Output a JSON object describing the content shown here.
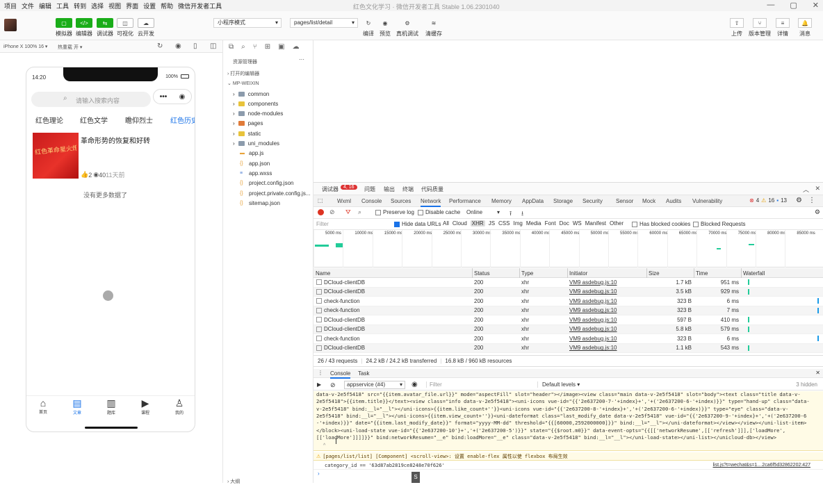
{
  "menu": [
    "项目",
    "文件",
    "编辑",
    "工具",
    "转到",
    "选择",
    "视图",
    "界面",
    "设置",
    "帮助",
    "微信开发者工具"
  ],
  "window_title": "红色文化学习 · 微信开发者工具 Stable 1.06.2301040",
  "toolbar": {
    "left": [
      {
        "label": "模拟器",
        "icon": "▢"
      },
      {
        "label": "编辑器",
        "icon": "</>"
      },
      {
        "label": "调试器",
        "icon": "⇆"
      },
      {
        "label": "可视化",
        "icon": "◫"
      },
      {
        "label": "云开发",
        "icon": "☁"
      }
    ],
    "compile_mode": "小程序模式",
    "page_path": "pages/list/detail",
    "mid": [
      {
        "label": "编译",
        "icon": "↻"
      },
      {
        "label": "预览",
        "icon": "◉"
      },
      {
        "label": "真机调试",
        "icon": "⚙"
      },
      {
        "label": "清缓存",
        "icon": "≋"
      }
    ],
    "right": [
      {
        "label": "上传",
        "icon": "⇧"
      },
      {
        "label": "版本管理",
        "icon": "⑂"
      },
      {
        "label": "详情",
        "icon": "≡"
      },
      {
        "label": "消息",
        "icon": "🔔"
      }
    ]
  },
  "simbar": {
    "device": "iPhone X 100% 16 ▾",
    "hotreload": "热重载 开 ▾"
  },
  "phone": {
    "time": "14:20",
    "battery": "100%",
    "search_placeholder": "请输入搜索内容",
    "tabs": [
      "红色理论",
      "红色文学",
      "瞻仰烈士",
      "红色历史"
    ],
    "article": {
      "title": "革命形势的恢复和好转",
      "likes": "2",
      "views": "40",
      "date": "11天前",
      "thumb_text": "红色革命星火燎原"
    },
    "no_more": "没有更多数据了",
    "nav": [
      "首页",
      "文章",
      "题库",
      "课程",
      "我的"
    ]
  },
  "explorer": {
    "title": "资源管理器",
    "open_editors": "打开的编辑器",
    "project": "MP-WEIXIN",
    "items": [
      {
        "name": "common",
        "type": "folder"
      },
      {
        "name": "components",
        "type": "folder-y"
      },
      {
        "name": "node-modules",
        "type": "folder"
      },
      {
        "name": "pages",
        "type": "folder-o"
      },
      {
        "name": "static",
        "type": "folder-y"
      },
      {
        "name": "uni_modules",
        "type": "folder"
      },
      {
        "name": "app.js",
        "type": "js"
      },
      {
        "name": "app.json",
        "type": "json"
      },
      {
        "name": "app.wxss",
        "type": "wxss"
      },
      {
        "name": "project.config.json",
        "type": "json"
      },
      {
        "name": "project.private.config.js...",
        "type": "json"
      },
      {
        "name": "sitemap.json",
        "type": "json"
      }
    ],
    "outline": "大纲"
  },
  "devtools": {
    "top_tabs": [
      "调试器",
      "问题",
      "输出",
      "终端",
      "代码质量"
    ],
    "badge": "4, 16",
    "panel_tabs": [
      "Wxml",
      "Console",
      "Sources",
      "Network",
      "Performance",
      "Memory",
      "AppData",
      "Storage",
      "Security",
      "Sensor",
      "Mock",
      "Audits",
      "Vulnerability"
    ],
    "err_count": "4",
    "warn_count": "16",
    "info_count": "13",
    "preserve_log": "Preserve log",
    "disable_cache": "Disable cache",
    "throttle": "Online",
    "filter_placeholder": "Filter",
    "hide_data_urls": "Hide data URLs",
    "types": [
      "All",
      "Cloud",
      "XHR",
      "JS",
      "CSS",
      "Img",
      "Media",
      "Font",
      "Doc",
      "WS",
      "Manifest",
      "Other"
    ],
    "blocked_cookies": "Has blocked cookies",
    "blocked_requests": "Blocked Requests",
    "timeline": [
      "5000 ms",
      "10000 ms",
      "15000 ms",
      "20000 ms",
      "25000 ms",
      "30000 ms",
      "35000 ms",
      "40000 ms",
      "45000 ms",
      "50000 ms",
      "55000 ms",
      "60000 ms",
      "65000 ms",
      "70000 ms",
      "75000 ms",
      "80000 ms",
      "85000 ms"
    ],
    "columns": [
      "Name",
      "Status",
      "Type",
      "Initiator",
      "Size",
      "Time",
      "Waterfall"
    ],
    "rows": [
      {
        "name": "DCloud-clientDB",
        "status": "200",
        "type": "xhr",
        "initiator": "VM9 asdebug.js:10",
        "size": "1.7 kB",
        "time": "951 ms"
      },
      {
        "name": "DCloud-clientDB",
        "status": "200",
        "type": "xhr",
        "initiator": "VM9 asdebug.js:10",
        "size": "3.5 kB",
        "time": "929 ms"
      },
      {
        "name": "check-function",
        "status": "200",
        "type": "xhr",
        "initiator": "VM9 asdebug.js:10",
        "size": "323 B",
        "time": "6 ms"
      },
      {
        "name": "check-function",
        "status": "200",
        "type": "xhr",
        "initiator": "VM9 asdebug.js:10",
        "size": "323 B",
        "time": "7 ms"
      },
      {
        "name": "DCloud-clientDB",
        "status": "200",
        "type": "xhr",
        "initiator": "VM9 asdebug.js:10",
        "size": "597 B",
        "time": "410 ms"
      },
      {
        "name": "DCloud-clientDB",
        "status": "200",
        "type": "xhr",
        "initiator": "VM9 asdebug.js:10",
        "size": "5.8 kB",
        "time": "579 ms"
      },
      {
        "name": "check-function",
        "status": "200",
        "type": "xhr",
        "initiator": "VM9 asdebug.js:10",
        "size": "323 B",
        "time": "6 ms"
      },
      {
        "name": "DCloud-clientDB",
        "status": "200",
        "type": "xhr",
        "initiator": "VM9 asdebug.js:10",
        "size": "1.1 kB",
        "time": "543 ms"
      }
    ],
    "summary": [
      "26 / 43 requests",
      "24.2 kB / 24.2 kB transferred",
      "16.8 kB / 960 kB resources"
    ],
    "console_tabs": [
      "Console",
      "Task"
    ],
    "context": "appservice (#4)",
    "filter2": "Filter",
    "levels": "Default levels ▾",
    "hidden": "3 hidden",
    "console_lines": [
      "data-v-2e5f5418\" src=\"{{item.avatar_file.url}}\" mode=\"aspectFill\" slot=\"header\"></image><view class=\"main data-v-2e5f5418\" slot=\"body\"><text class=\"title data-v-",
      "2e5f5418\">{{item.title}}</text><view class=\"info data-v-2e5f5418\"><uni-icons vue-id=\"{{'2e637200-7-'+index}+','+('2e637200-6-'+index)}}\" type=\"hand-up\" class=\"data-",
      "v-2e5f5418\" bind:__l=\"__l\"></uni-icons>{{item.like_count+''}}<uni-icons vue-id=\"{{'2e637200-8-'+index}+','+('2e637200-6-'+index)}}\" type=\"eye\" class=\"data-v-",
      "2e5f5418\" bind:__l=\"__l\"></uni-icons>{{item.view_count+''}}<uni-dateformat class=\"last_modify_date data-v-2e5f5418\" vue-id=\"{{'2e637200-9-'+index}+','+('2e637200-6",
      "-'+index)}}\" date=\"{{item.last_modify_date}}\" format=\"yyyy-MM-dd\" threshold=\"{{[60000,2592000000]}}\" bind:__l=\"__l\"></uni-dateformat></view></view></uni-list-item>",
      "</block><uni-load-state vue-id=\"{{'2e637200-10'}+','+('2e637200-5')}}\" state=\"{{$root.m0}}\" data-event-opts=\"{{[['networkResume',[['refresh']]],['loadMore',",
      "[['loadMore']]]]}}\" bind:networkResume=\"__e\" bind:loadMore=\"__e\" class=\"data-v-2e5f5418\" bind:__l=\"__l\"></uni-load-state></uni-list></unicloud-db></view>"
    ],
    "warning": "[pages/list/list] [Component] <scroll-view>: 设置 enable-flex 属性以使 flexbox 布局生效",
    "log": "category_id == '63d87ab2819ce8248e70f626'",
    "log_src": "list.js?t=wechat&s=1…2ca6f5d32862202:427"
  }
}
